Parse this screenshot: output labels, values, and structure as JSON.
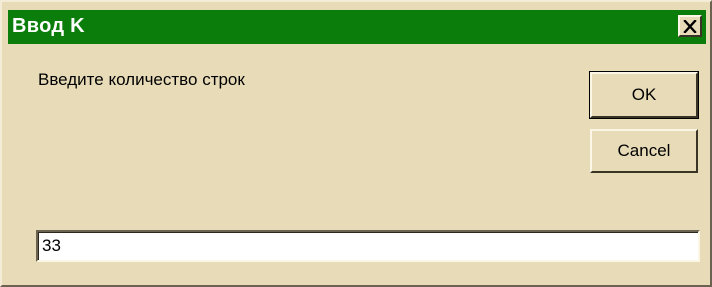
{
  "window": {
    "title": "Ввод K",
    "close_icon": "close-icon"
  },
  "dialog": {
    "prompt": "Введите количество строк",
    "value": "33"
  },
  "buttons": {
    "ok_label": "OK",
    "cancel_label": "Cancel"
  },
  "colors": {
    "titlebar": "#0a7d0a",
    "face": "#e8dcb8",
    "title_text": "#ffffff"
  }
}
